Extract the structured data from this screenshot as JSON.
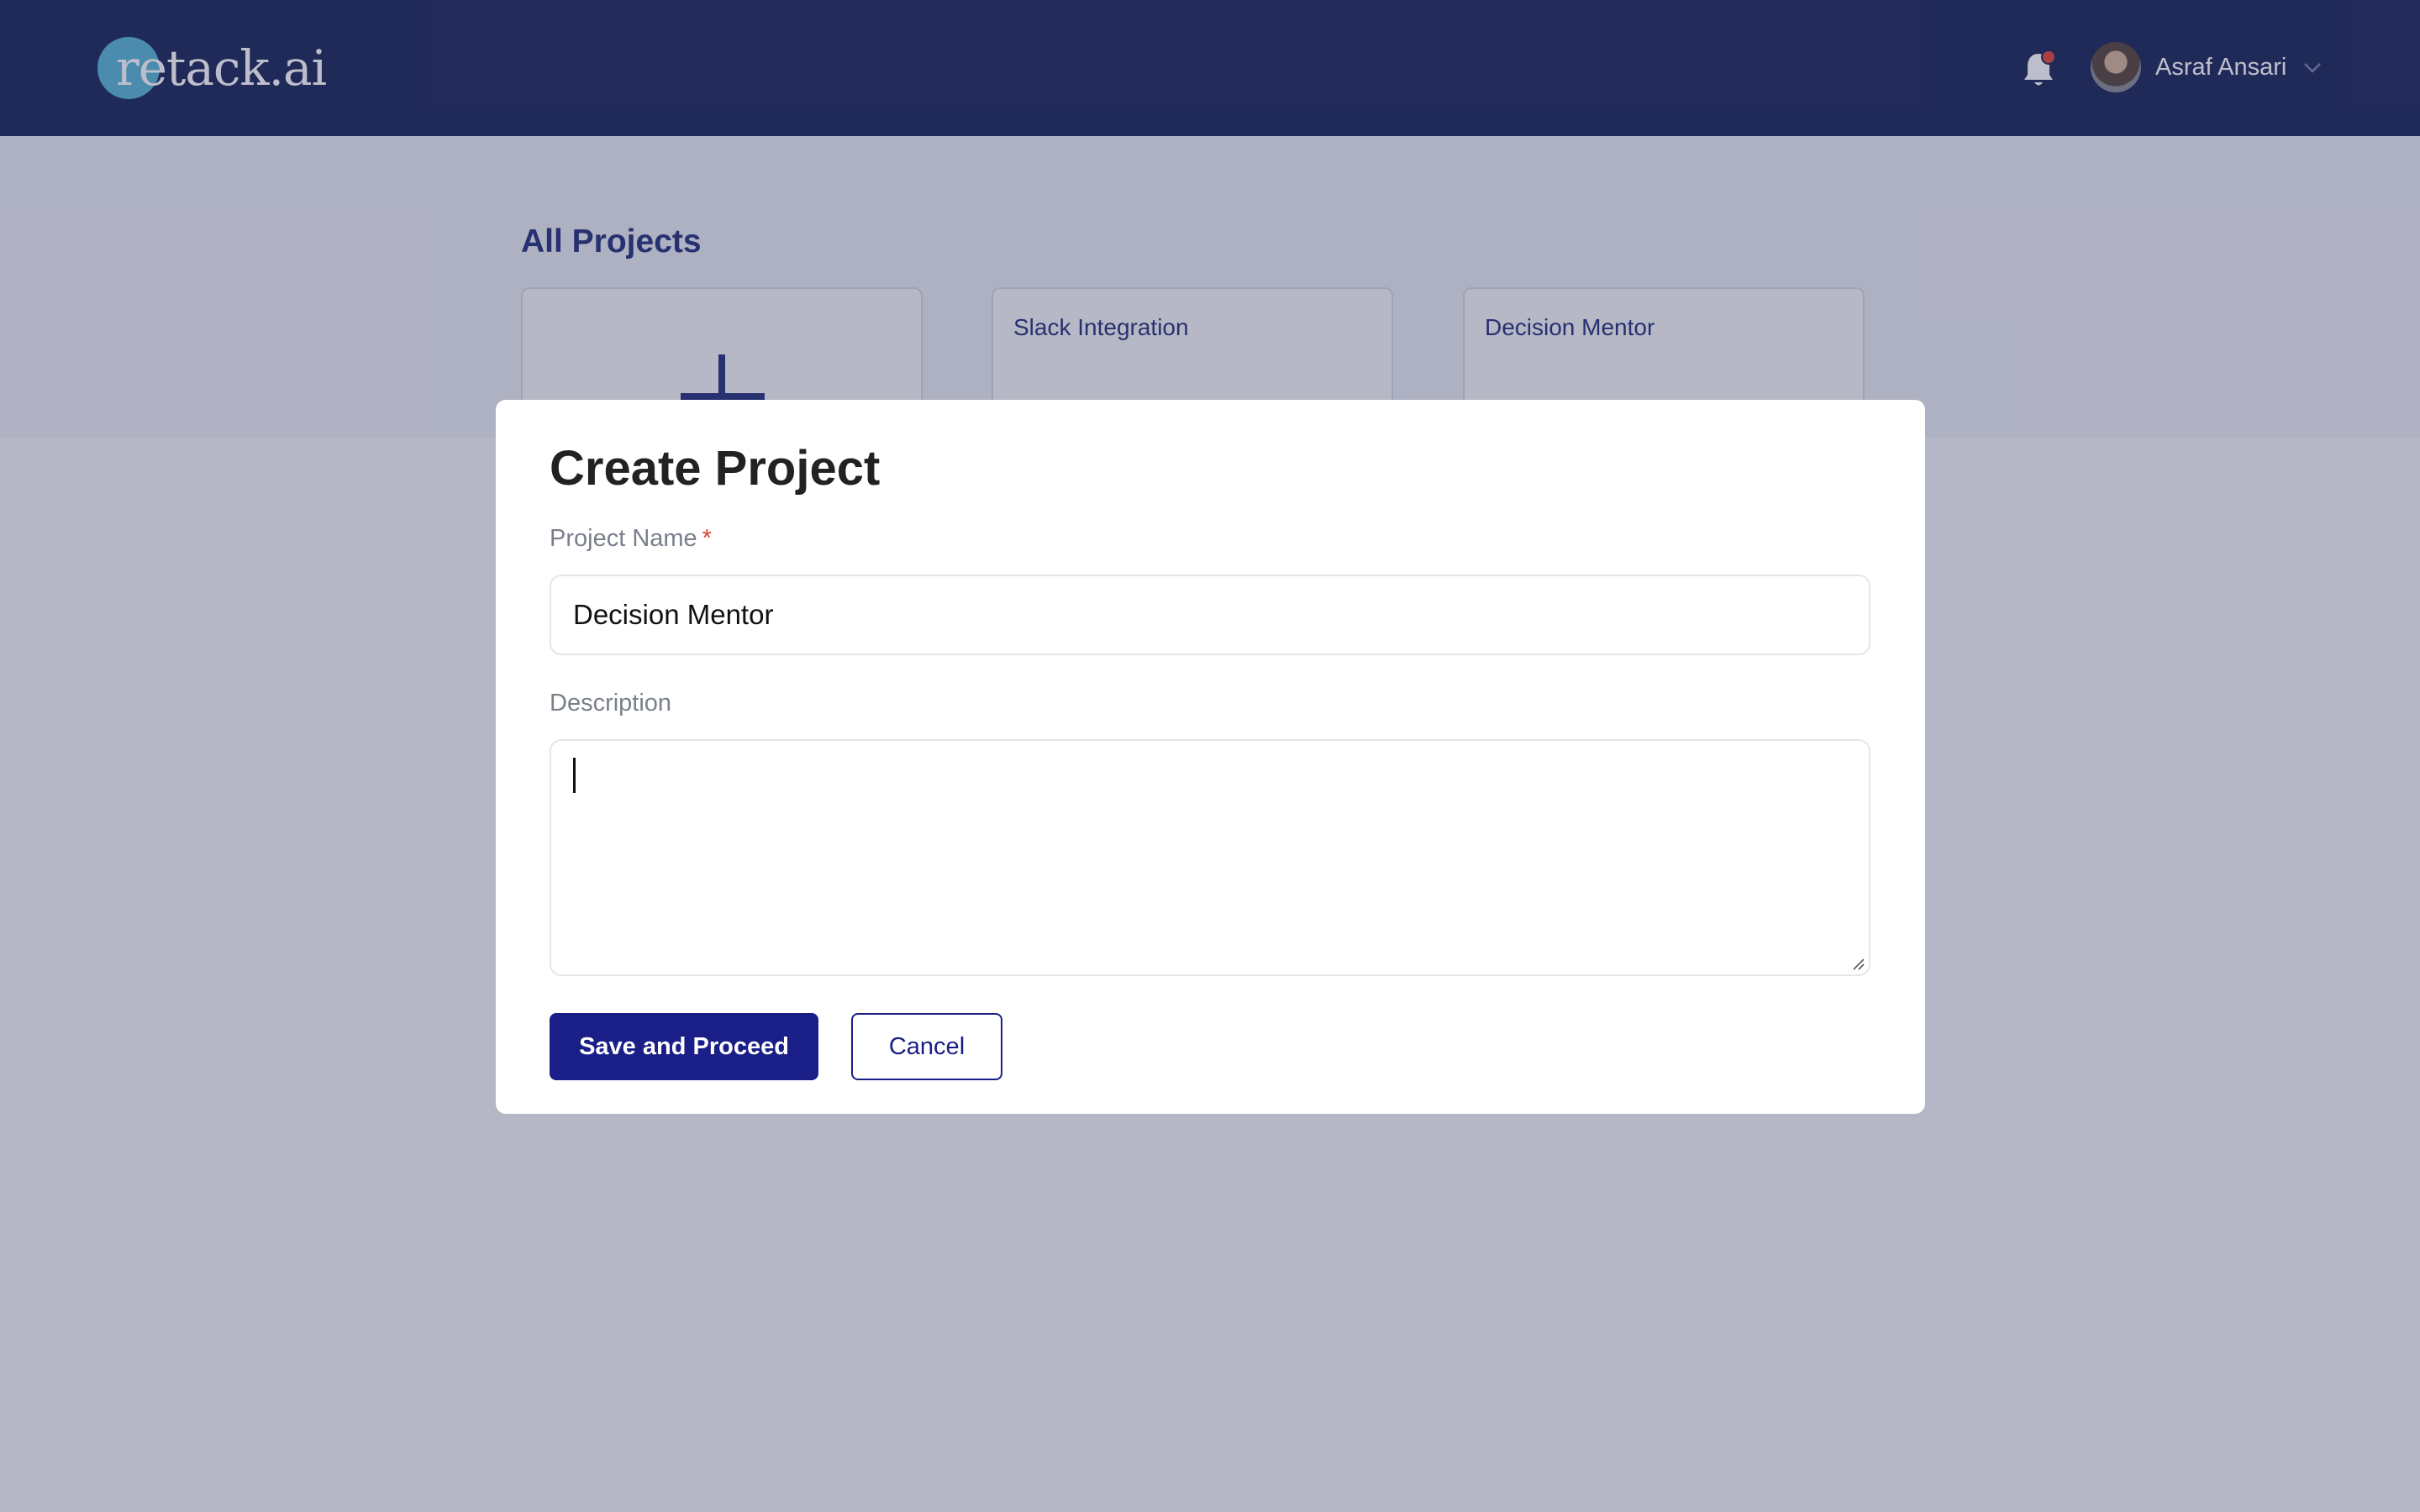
{
  "header": {
    "logo_text": "retack.ai",
    "user_name": "Asraf Ansari",
    "notification_has_unread": true
  },
  "projects": {
    "section_title": "All Projects",
    "cards": [
      {
        "title": "Slack Integration"
      },
      {
        "title": "Decision Mentor"
      }
    ]
  },
  "modal": {
    "title": "Create Project",
    "name_label": "Project Name",
    "name_required_mark": "*",
    "name_value": "Decision Mentor",
    "description_label": "Description",
    "description_value": "",
    "save_label": "Save and Proceed",
    "cancel_label": "Cancel"
  },
  "colors": {
    "header_bg": "#1f2b5b",
    "logo_circle": "#5bb6d6",
    "primary": "#1a1e87",
    "accent_title": "#2a3680",
    "notification_dot": "#e24a3b",
    "required": "#d9443a"
  },
  "icons": [
    "bell-icon",
    "avatar",
    "chevron-down-icon",
    "plus-icon",
    "resize-handle-icon"
  ]
}
